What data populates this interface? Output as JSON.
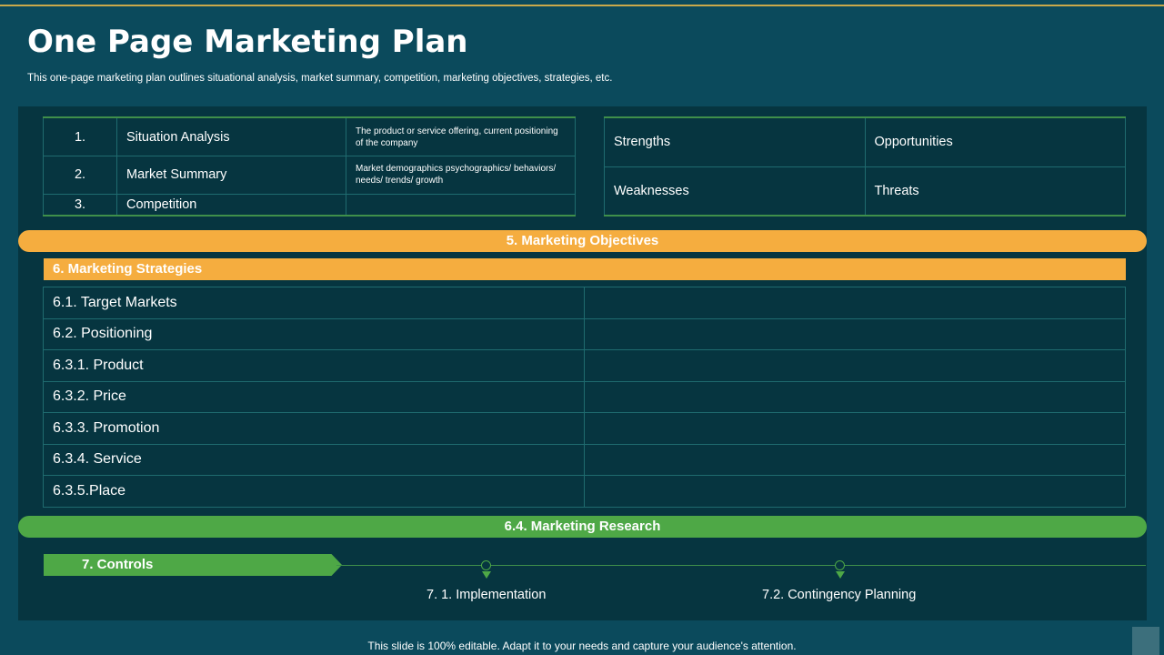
{
  "header": {
    "title": "One Page Marketing Plan",
    "subtitle": "This one-page marketing plan outlines situational analysis, market summary, competition, marketing objectives, strategies, etc."
  },
  "analysis_table": [
    {
      "num": "1.",
      "label": "Situation Analysis",
      "desc": "The product or service offering, current positioning of the company"
    },
    {
      "num": "2.",
      "label": "Market Summary",
      "desc": "Market demographics psychographics/ behaviors/ needs/ trends/ growth"
    },
    {
      "num": "3.",
      "label": "Competition",
      "desc": ""
    }
  ],
  "swot": {
    "strengths": "Strengths",
    "opportunities": "Opportunities",
    "weaknesses": "Weaknesses",
    "threats": "Threats"
  },
  "objectives_label": "5. Marketing Objectives",
  "strategies_label": "6. Marketing Strategies",
  "strategies": [
    "6.1. Target Markets",
    "6.2. Positioning",
    "6.3.1. Product",
    "6.3.2. Price",
    "6.3.3. Promotion",
    "6.3.4. Service",
    "6.3.5.Place"
  ],
  "research_label": "6.4. Marketing Research",
  "controls": {
    "label": "7. Controls",
    "items": [
      "7. 1. Implementation",
      "7.2. Contingency Planning"
    ]
  },
  "footer": "This slide is 100% editable. Adapt it to your needs and capture your audience's attention.",
  "colors": {
    "background": "#0b4a5c",
    "panel": "#063540",
    "orange": "#f5ad3f",
    "green": "#4ea846",
    "gold_line": "#c9a94a"
  }
}
